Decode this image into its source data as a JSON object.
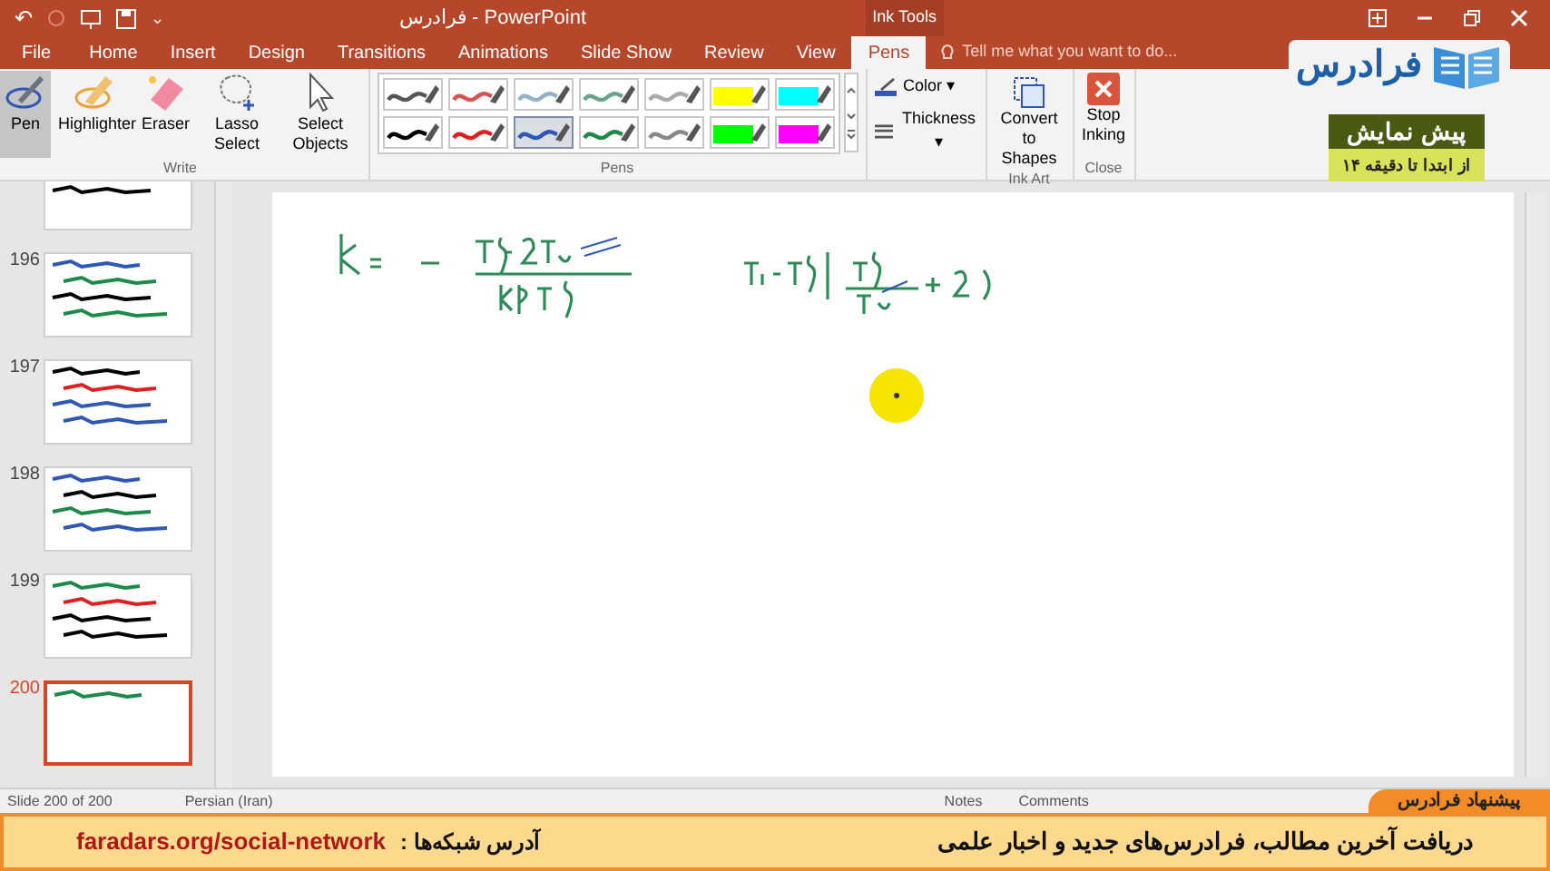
{
  "window": {
    "title": "فرادرس - PowerPoint",
    "context_tab": "Ink Tools"
  },
  "quick_access": [
    "↶",
    "⌄"
  ],
  "tabs": [
    {
      "label": "File",
      "selected": false
    },
    {
      "label": "Home",
      "selected": false
    },
    {
      "label": "Insert",
      "selected": false
    },
    {
      "label": "Design",
      "selected": false
    },
    {
      "label": "Transitions",
      "selected": false
    },
    {
      "label": "Animations",
      "selected": false
    },
    {
      "label": "Slide Show",
      "selected": false
    },
    {
      "label": "Review",
      "selected": false
    },
    {
      "label": "View",
      "selected": false
    },
    {
      "label": "Pens",
      "selected": true
    }
  ],
  "tell_me": {
    "placeholder": "Tell me what you want to do..."
  },
  "logo": {
    "text": "فرادرس"
  },
  "write_group": {
    "label": "Write",
    "tools": [
      {
        "kind": "pen",
        "label": "Pen",
        "selected": true
      },
      {
        "kind": "highlighter",
        "label": "Highlighter",
        "selected": false
      },
      {
        "kind": "eraser",
        "label": "Eraser",
        "selected": false
      },
      {
        "kind": "lasso",
        "label": "Lasso Select",
        "selected": false
      },
      {
        "kind": "select",
        "label": "Select Objects",
        "selected": false
      }
    ]
  },
  "pens_group": {
    "label": "Pens",
    "pens": [
      {
        "kind": "pen",
        "color": "#555555",
        "selected": false
      },
      {
        "kind": "pen",
        "color": "#d9534f",
        "selected": false
      },
      {
        "kind": "pen",
        "color": "#8fb3c9",
        "selected": false
      },
      {
        "kind": "pen",
        "color": "#6aa58a",
        "selected": false
      },
      {
        "kind": "pen",
        "color": "#aaaaaa",
        "selected": false
      },
      {
        "kind": "highlighter",
        "color": "#ffff00",
        "selected": false
      },
      {
        "kind": "highlighter",
        "color": "#00ffff",
        "selected": false
      },
      {
        "kind": "pen",
        "color": "#000000",
        "selected": false
      },
      {
        "kind": "pen",
        "color": "#e02020",
        "selected": false
      },
      {
        "kind": "pen",
        "color": "#2f57b5",
        "selected": true
      },
      {
        "kind": "pen",
        "color": "#1e8a4a",
        "selected": false
      },
      {
        "kind": "pen",
        "color": "#888888",
        "selected": false
      },
      {
        "kind": "highlighter",
        "color": "#00ff00",
        "selected": false
      },
      {
        "kind": "highlighter",
        "color": "#ff00ff",
        "selected": false
      }
    ]
  },
  "format": {
    "color_label": "Color",
    "thickness_label": "Thickness",
    "dropdown_arrow": "▾"
  },
  "ink_art": {
    "button": "Convert to Shapes",
    "label": "Ink Art"
  },
  "close_group": {
    "button": "Stop Inking",
    "label": "Close"
  },
  "preview_badge": {
    "title": "پیش نمایش",
    "subtitle": "از ابتدا تا دقیقه ۱۴"
  },
  "slides": [
    {
      "selected": false
    },
    {
      "number": "196",
      "selected": false
    },
    {
      "number": "197",
      "selected": false
    },
    {
      "number": "198",
      "selected": false
    },
    {
      "number": "199",
      "selected": false
    },
    {
      "number": "200",
      "selected": true
    }
  ],
  "status_bar": {
    "slide": "Slide 200 of 200",
    "language": "Persian (Iran)",
    "notes": "Notes",
    "comments": "Comments"
  },
  "banner": {
    "tab": "پیشنهاد فرادرس",
    "message": "دریافت آخرین مطالب، فرادرس‌های جدید و اخبار علمی",
    "address_label": "آدرس شبکه‌ها :",
    "link": "faradars.org/social-network"
  }
}
